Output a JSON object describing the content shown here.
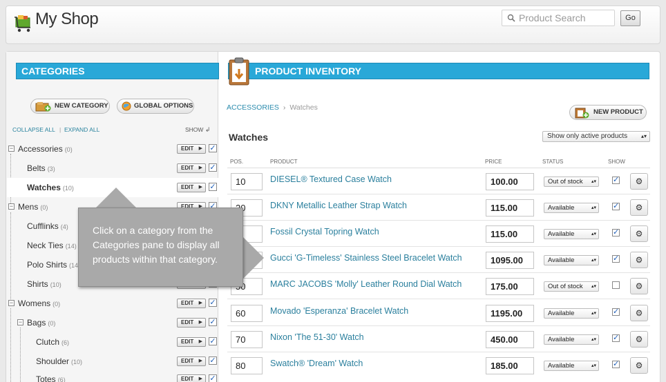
{
  "app": {
    "title": "My Shop",
    "logo_icon": "shopping-cart-icon"
  },
  "search": {
    "placeholder": "Product Search",
    "go_label": "Go"
  },
  "categories_pane": {
    "title": "Categories",
    "new_category_label": "New Category",
    "global_options_label": "Global Options",
    "collapse_all": "Collapse All",
    "separator": "|",
    "expand_all": "Expand All",
    "show_label": "Show",
    "edit_label": "EDIT",
    "items": [
      {
        "name": "Accessories",
        "count": "(0)"
      },
      {
        "name": "Belts",
        "count": "(3)"
      },
      {
        "name": "Watches",
        "count": "(10)"
      },
      {
        "name": "Mens",
        "count": "(0)"
      },
      {
        "name": "Cufflinks",
        "count": "(4)"
      },
      {
        "name": "Neck Ties",
        "count": "(14)"
      },
      {
        "name": "Polo Shirts",
        "count": "(14)"
      },
      {
        "name": "Shirts",
        "count": "(10)"
      },
      {
        "name": "Womens",
        "count": "(0)"
      },
      {
        "name": "Bags",
        "count": "(0)"
      },
      {
        "name": "Clutch",
        "count": "(6)"
      },
      {
        "name": "Shoulder",
        "count": "(10)"
      },
      {
        "name": "Totes",
        "count": "(6)"
      }
    ]
  },
  "inventory_pane": {
    "title": "Product Inventory",
    "breadcrumb": {
      "parent": "Accessories",
      "separator": "›",
      "current": "Watches"
    },
    "new_product_label": "New Product",
    "section_title": "Watches",
    "filter_value": "Show only active products",
    "columns": {
      "pos": "Pos.",
      "product": "Product",
      "price": "Price",
      "status": "Status",
      "show": "Show"
    },
    "products": [
      {
        "pos": "10",
        "name": "DIESEL® Textured Case Watch",
        "price": "100.00",
        "status": "Out of stock",
        "show": true
      },
      {
        "pos": "20",
        "name": "DKNY Metallic Leather Strap Watch",
        "price": "115.00",
        "status": "Available",
        "show": true
      },
      {
        "pos": "",
        "name": "Fossil Crystal Topring Watch",
        "price": "115.00",
        "status": "Available",
        "show": true
      },
      {
        "pos": "",
        "name": "Gucci 'G-Timeless' Stainless Steel Bracelet Watch",
        "price": "1095.00",
        "status": "Available",
        "show": true
      },
      {
        "pos": "50",
        "name": "MARC JACOBS 'Molly' Leather Round Dial Watch",
        "price": "175.00",
        "status": "Out of stock",
        "show": false
      },
      {
        "pos": "60",
        "name": "Movado 'Esperanza' Bracelet Watch",
        "price": "1195.00",
        "status": "Available",
        "show": true
      },
      {
        "pos": "70",
        "name": "Nixon 'The 51-30' Watch",
        "price": "450.00",
        "status": "Available",
        "show": true
      },
      {
        "pos": "80",
        "name": "Swatch® 'Dream' Watch",
        "price": "185.00",
        "status": "Available",
        "show": true
      }
    ]
  },
  "callout": {
    "text": "Click on a category from the Categories pane to display all products within that category."
  },
  "colors": {
    "accent": "#29a8d8",
    "link": "#2a7f9d",
    "callout": "#a9a9a9"
  }
}
